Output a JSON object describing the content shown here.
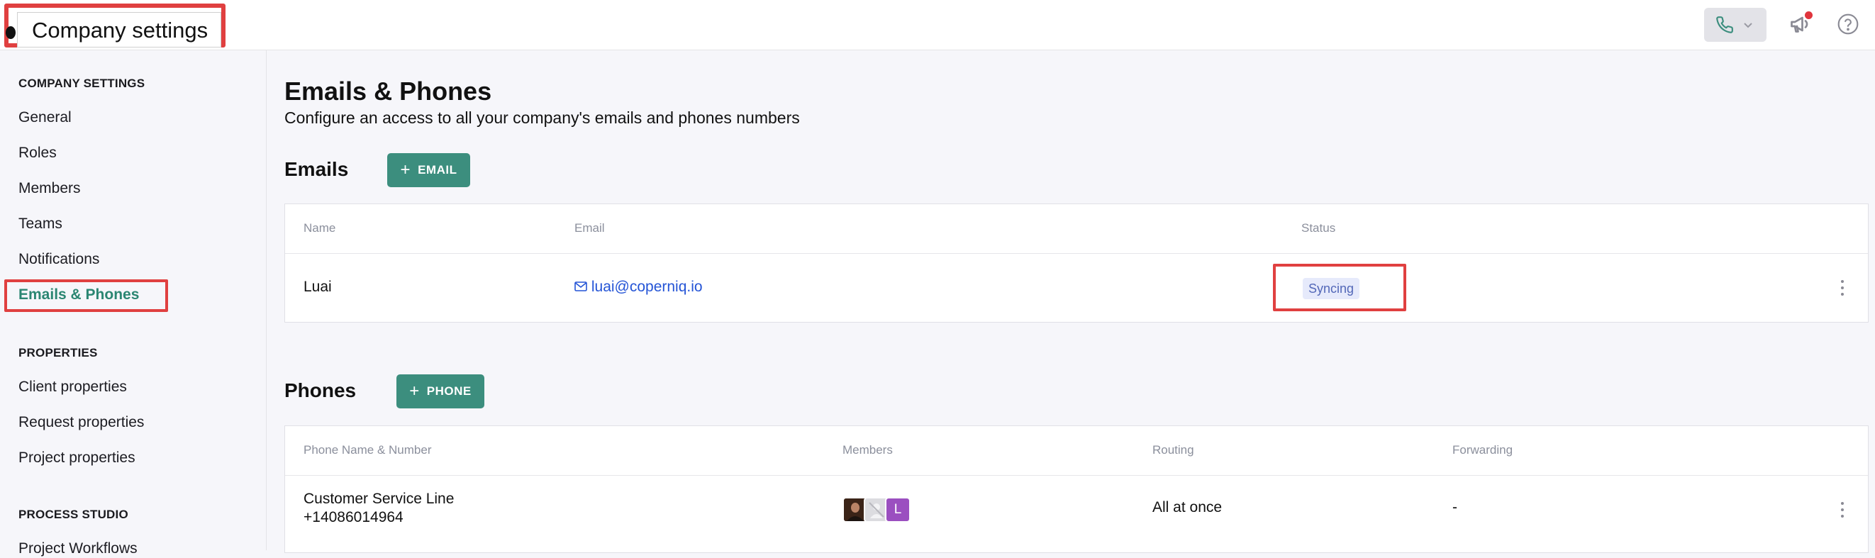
{
  "header": {
    "title": "Company settings",
    "icons": [
      "phone-icon",
      "chevron-down-icon",
      "megaphone-icon",
      "help-icon"
    ]
  },
  "sidebar": {
    "sections": [
      {
        "title": "COMPANY SETTINGS",
        "items": [
          "General",
          "Roles",
          "Members",
          "Teams",
          "Notifications",
          "Emails & Phones"
        ]
      },
      {
        "title": "PROPERTIES",
        "items": [
          "Client properties",
          "Request properties",
          "Project properties"
        ]
      },
      {
        "title": "PROCESS STUDIO",
        "items": [
          "Project Workflows"
        ]
      }
    ],
    "active_item": "Emails & Phones"
  },
  "main": {
    "title": "Emails & Phones",
    "subtitle": "Configure an access to all your company's emails and phones numbers",
    "emails": {
      "title": "Emails",
      "add_button": "EMAIL",
      "columns": [
        "Name",
        "Email",
        "Status"
      ],
      "rows": [
        {
          "name": "Luai",
          "email": "luai@coperniq.io",
          "status": "Syncing"
        }
      ]
    },
    "phones": {
      "title": "Phones",
      "add_button": "PHONE",
      "columns": [
        "Phone Name & Number",
        "Members",
        "Routing",
        "Forwarding"
      ],
      "rows": [
        {
          "name": "Customer Service Line",
          "number": "+14086014964",
          "member_initial": "L",
          "routing": "All at once",
          "forwarding": "-"
        }
      ]
    }
  },
  "colors": {
    "accent": "#3c8e7e",
    "active_nav": "#2b8672",
    "link": "#2454d6",
    "status_badge_bg": "#e6eafb",
    "highlight": "#e04040"
  }
}
